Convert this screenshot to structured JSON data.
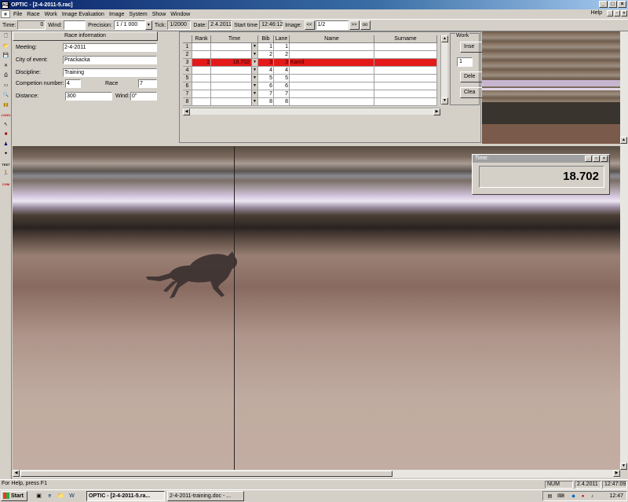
{
  "window": {
    "title": "OPTIC - [2-4-2011-5.rac]",
    "app_badge": "AGE"
  },
  "menu": {
    "items": [
      "File",
      "Race",
      "Work",
      "Image Evaluation",
      "Image",
      "System",
      "Show",
      "Window"
    ],
    "help": "Help"
  },
  "toolbar": {
    "time_label": "Time:",
    "time_value": "0",
    "wind_label": "Wind:",
    "wind_value": "",
    "precision_label": "Precision:",
    "precision_value": "1 / 1 000",
    "tick_label": "Tick:",
    "tick_value": "1/2000",
    "date_label": "Date:",
    "date_value": "2.4.2011",
    "start_label": "Start time",
    "start_value": "12:46:12",
    "image_label": "Image:",
    "image_value": "1/2",
    "prev_label": "<<",
    "next_label": ">>",
    "extra_label": "oo"
  },
  "race_info": {
    "header": "Race information",
    "meeting_label": "Meeting:",
    "meeting_value": "2-4-2011",
    "city_label": "City of event:",
    "city_value": "Prackacka",
    "discipline_label": "Discipline:",
    "discipline_value": "Training",
    "comp_label": "Competion number:",
    "comp_value": "4",
    "race_label": "Race",
    "race_value": "7",
    "distance_label": "Distance:",
    "distance_value": "300",
    "wind_label": "Wind:",
    "wind_value": "0\""
  },
  "grid": {
    "columns": [
      "Rank",
      "Time",
      "Bib",
      "Lane",
      "Name",
      "Surname"
    ],
    "rows": [
      {
        "n": "1",
        "rank": "",
        "time": "",
        "bib": "1",
        "lane": "1",
        "name": "",
        "surname": ""
      },
      {
        "n": "2",
        "rank": "",
        "time": "",
        "bib": "2",
        "lane": "2",
        "name": "",
        "surname": ""
      },
      {
        "n": "3",
        "rank": "1",
        "time": "18.702",
        "bib": "3",
        "lane": "3",
        "name": "Kamil",
        "surname": ""
      },
      {
        "n": "4",
        "rank": "",
        "time": "",
        "bib": "4",
        "lane": "4",
        "name": "",
        "surname": ""
      },
      {
        "n": "5",
        "rank": "",
        "time": "",
        "bib": "5",
        "lane": "5",
        "name": "",
        "surname": ""
      },
      {
        "n": "6",
        "rank": "",
        "time": "",
        "bib": "6",
        "lane": "6",
        "name": "",
        "surname": ""
      },
      {
        "n": "7",
        "rank": "",
        "time": "",
        "bib": "7",
        "lane": "7",
        "name": "",
        "surname": ""
      },
      {
        "n": "8",
        "rank": "",
        "time": "",
        "bib": "8",
        "lane": "8",
        "name": "",
        "surname": ""
      }
    ]
  },
  "work": {
    "label": "Work",
    "insert": "Inse",
    "spin_value": "1",
    "delete": "Dele",
    "clear": "Clea"
  },
  "time_window": {
    "title": "Time:",
    "value": "18.702"
  },
  "status": {
    "help_text": "For Help, press F1",
    "num": "NUM",
    "date": "2.4.2011",
    "time": "12:47:09"
  },
  "taskbar": {
    "start": "Start",
    "tasks": [
      "OPTIC - [2-4-2011-5.ra...",
      "2-4-2011-training.doc - ..."
    ],
    "clock": "12:47"
  },
  "left_tools": [
    "new-icon",
    "open-icon",
    "save-icon",
    "delete-icon",
    "print-icon",
    "preview-icon",
    "zoom-icon",
    "barcode-icon",
    "logo-icon",
    "pointer-icon",
    "marker-icon",
    "user-icon",
    "photo-cell-icon",
    "test-icon",
    "runner-icon",
    "com-icon"
  ],
  "colors": {
    "selected_row": "#e41a1a",
    "title_bar": "#0a246a",
    "face": "#d4d0c8"
  }
}
